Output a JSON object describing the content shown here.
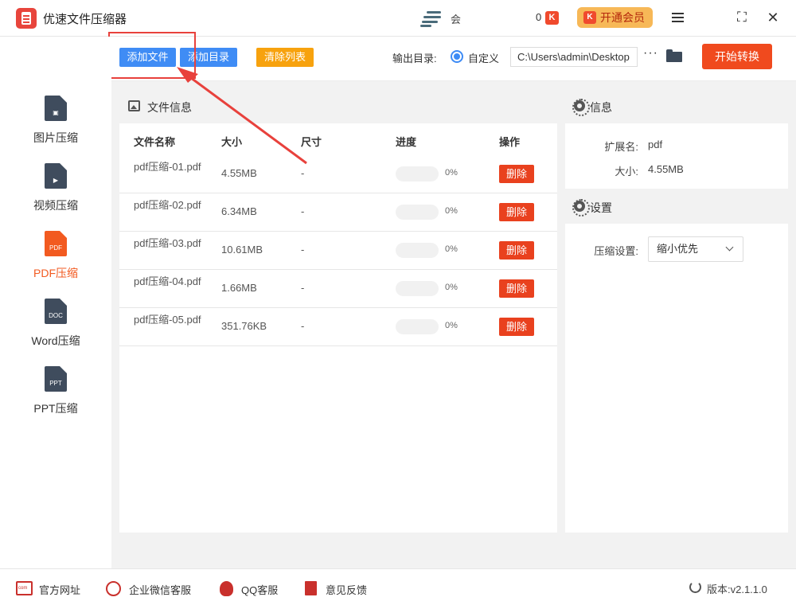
{
  "app": {
    "title": "优速文件压缩器",
    "user_name": "会",
    "coin_count": "0",
    "coin_icon": "K",
    "vip_label": "开通会员",
    "vip_icon": "K"
  },
  "toolbar": {
    "add_file": "添加文件",
    "add_folder": "添加目录",
    "clear_list": "清除列表",
    "output_label": "输出目录:",
    "custom_label": "自定义",
    "output_path": "C:\\Users\\admin\\Desktop",
    "more": "···",
    "start_label": "开始转换"
  },
  "sidebar": {
    "items": [
      {
        "label": "图片压缩",
        "icon": "image-doc-icon",
        "glyph": "▣",
        "active": false
      },
      {
        "label": "视频压缩",
        "icon": "video-doc-icon",
        "glyph": "▶",
        "active": false
      },
      {
        "label": "PDF压缩",
        "icon": "pdf-doc-icon",
        "glyph": "PDF",
        "active": true
      },
      {
        "label": "Word压缩",
        "icon": "word-doc-icon",
        "glyph": "DOC",
        "active": false
      },
      {
        "label": "PPT压缩",
        "icon": "ppt-doc-icon",
        "glyph": "PPT",
        "active": false
      }
    ]
  },
  "file_panel": {
    "title": "文件信息",
    "columns": [
      "文件名称",
      "大小",
      "尺寸",
      "进度",
      "操作"
    ],
    "rows": [
      {
        "name": "pdf压缩-01.pdf",
        "size": "4.55MB",
        "dim": "-",
        "progress": 0,
        "progress_text": "0%",
        "action": "删除"
      },
      {
        "name": "pdf压缩-02.pdf",
        "size": "6.34MB",
        "dim": "-",
        "progress": 0,
        "progress_text": "0%",
        "action": "删除"
      },
      {
        "name": "pdf压缩-03.pdf",
        "size": "10.61MB",
        "dim": "-",
        "progress": 0,
        "progress_text": "0%",
        "action": "删除"
      },
      {
        "name": "pdf压缩-04.pdf",
        "size": "1.66MB",
        "dim": "-",
        "progress": 0,
        "progress_text": "0%",
        "action": "删除"
      },
      {
        "name": "pdf压缩-05.pdf",
        "size": "351.76KB",
        "dim": "-",
        "progress": 0,
        "progress_text": "0%",
        "action": "删除"
      }
    ]
  },
  "info_panel": {
    "title": "信息",
    "ext_label": "扩展名:",
    "ext_value": "pdf",
    "size_label": "大小:",
    "size_value": "4.55MB"
  },
  "settings_panel": {
    "title": "设置",
    "compress_label": "压缩设置:",
    "compress_value": "缩小优先"
  },
  "footer": {
    "website": "官方网址",
    "wechat": "企业微信客服",
    "qq": "QQ客服",
    "feedback": "意见反馈",
    "version": "版本:v2.1.1.0"
  },
  "colors": {
    "accent_blue": "#3f8cf5",
    "accent_orange": "#f7a20e",
    "danger_red": "#f04a1e",
    "active_orange": "#f25a20",
    "highlight_red": "#e8413c"
  }
}
